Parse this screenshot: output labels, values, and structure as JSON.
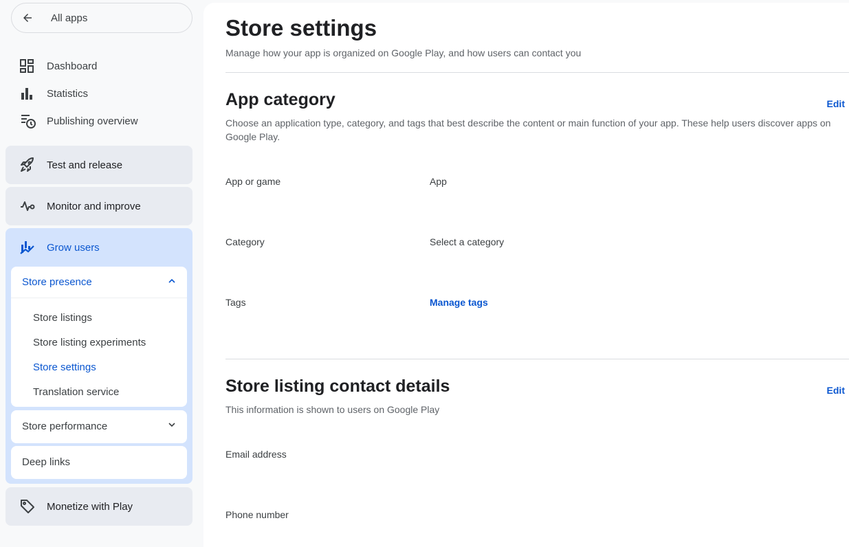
{
  "sidebar": {
    "all_apps_label": "All apps",
    "nav": [
      {
        "label": "Dashboard",
        "icon": "dashboard-icon"
      },
      {
        "label": "Statistics",
        "icon": "bar-chart-icon"
      },
      {
        "label": "Publishing overview",
        "icon": "publishing-overview-icon"
      }
    ],
    "groups": {
      "test": {
        "label": "Test and release",
        "icon": "rocket-icon"
      },
      "monitor": {
        "label": "Monitor and improve",
        "icon": "vitals-icon"
      },
      "grow": {
        "label": "Grow users",
        "icon": "grow-users-icon"
      },
      "monetize": {
        "label": "Monetize with Play",
        "icon": "tag-icon"
      }
    },
    "store_presence": {
      "label": "Store presence",
      "items": [
        "Store listings",
        "Store listing experiments",
        "Store settings",
        "Translation service"
      ],
      "active": "Store settings"
    },
    "store_performance": {
      "label": "Store performance"
    },
    "deep_links": {
      "label": "Deep links"
    }
  },
  "main": {
    "title": "Store settings",
    "subtitle": "Manage how your app is organized on Google Play, and how users can contact you",
    "app_category": {
      "title": "App category",
      "edit": "Edit",
      "description": "Choose an application type, category, and tags that best describe the content or main function of your app. These help users discover apps on Google Play.",
      "fields": {
        "type_label": "App or game",
        "type_value": "App",
        "category_label": "Category",
        "category_value": "Select a category",
        "tags_label": "Tags",
        "tags_link": "Manage tags"
      }
    },
    "contact": {
      "title": "Store listing contact details",
      "edit": "Edit",
      "description": "This information is shown to users on Google Play",
      "email_label": "Email address",
      "phone_label": "Phone number"
    }
  },
  "colors": {
    "accent": "#0b57d0",
    "active_group_bg": "#d3e3fd",
    "group_bg": "#e8ebf1"
  }
}
